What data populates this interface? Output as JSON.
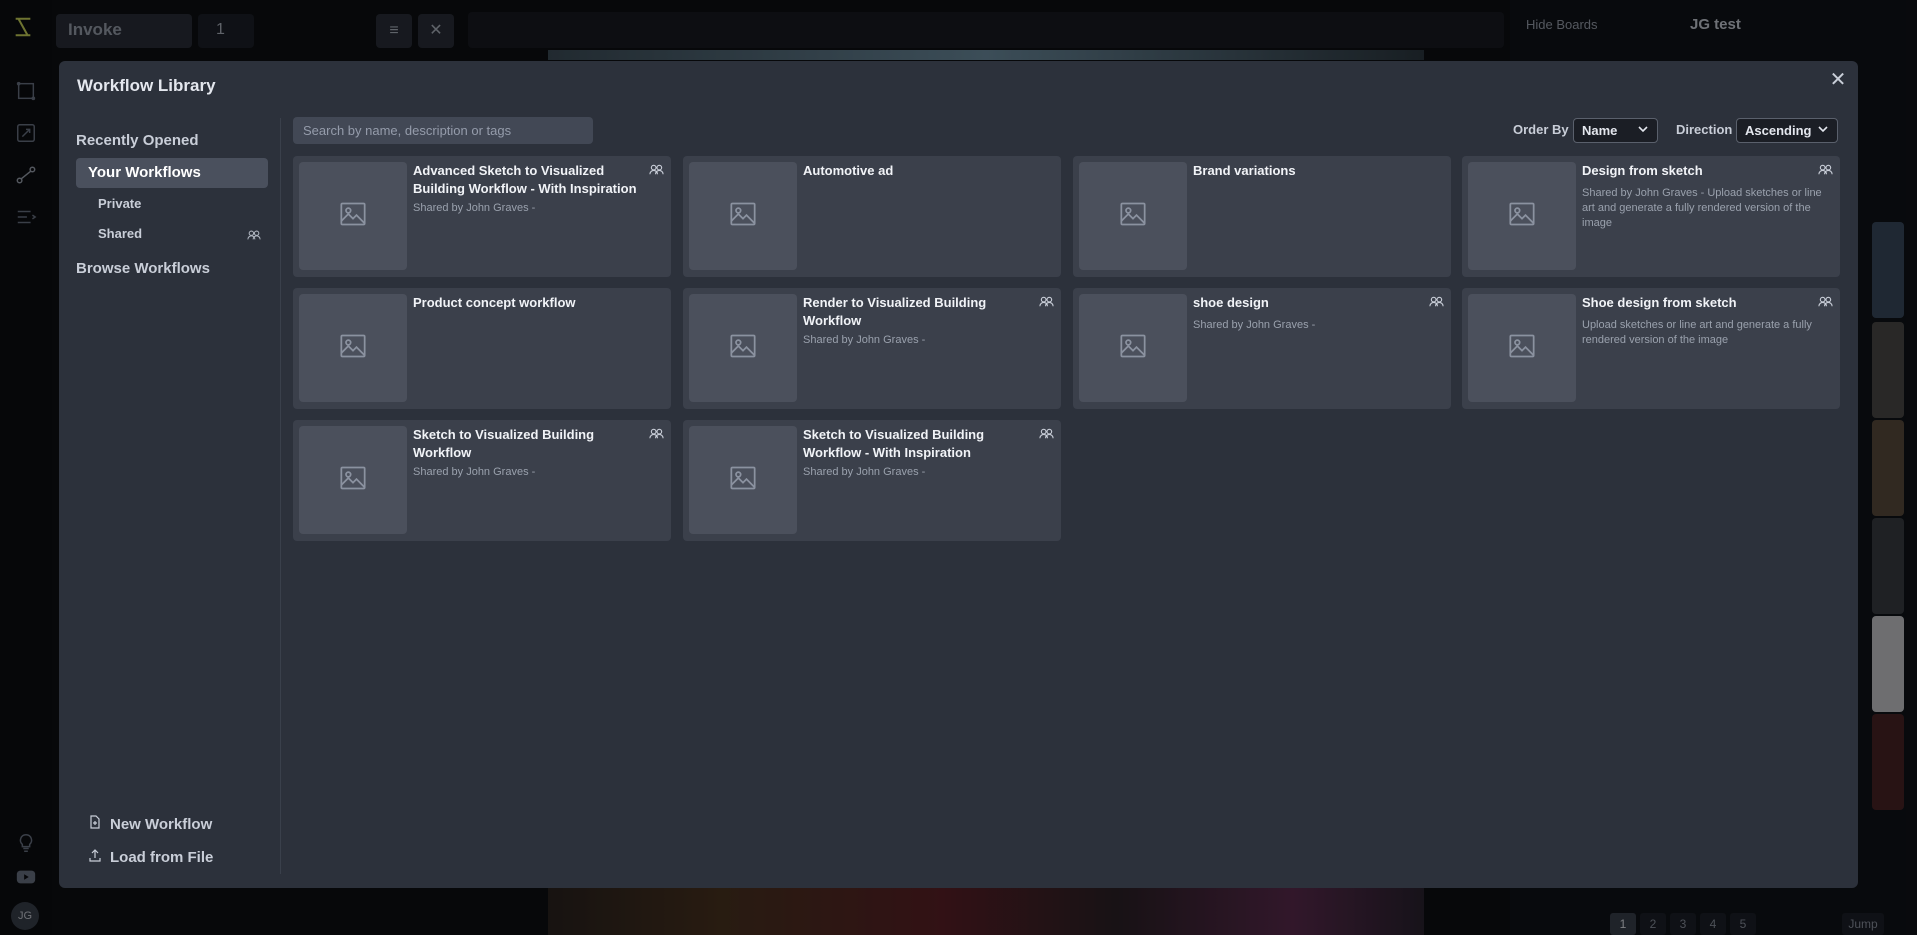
{
  "app": {
    "invoke_label": "Invoke",
    "iterations": "1",
    "hide_boards_label": "Hide Boards",
    "board_title": "JG test",
    "user_initials": "JG",
    "pages": [
      "1",
      "2",
      "3",
      "4",
      "5"
    ],
    "jump_label": "Jump"
  },
  "modal": {
    "title": "Workflow Library",
    "close_icon": "close-icon"
  },
  "sidebar": {
    "recently_opened": "Recently Opened",
    "your_workflows": "Your Workflows",
    "private": "Private",
    "shared": "Shared",
    "browse_workflows": "Browse Workflows",
    "new_workflow": "New Workflow",
    "load_from_file": "Load from File"
  },
  "controls": {
    "search_placeholder": "Search by name, description or tags",
    "order_by_label": "Order By",
    "order_by_value": "Name",
    "direction_label": "Direction",
    "direction_value": "Ascending"
  },
  "workflows": [
    {
      "title": "Advanced Sketch to Visualized Building Workflow - With Inspiration",
      "desc": "Shared by John Graves -",
      "shared": true
    },
    {
      "title": "Automotive ad",
      "desc": "",
      "shared": false
    },
    {
      "title": "Brand variations",
      "desc": "",
      "shared": false
    },
    {
      "title": "Design from sketch",
      "desc": "Shared by John Graves - Upload sketches or line art and generate a fully rendered version of the image",
      "shared": true
    },
    {
      "title": "Product concept workflow",
      "desc": "",
      "shared": false
    },
    {
      "title": "Render to Visualized Building Workflow",
      "desc": "Shared by John Graves -",
      "shared": true
    },
    {
      "title": "shoe design",
      "desc": "Shared by John Graves -",
      "shared": true
    },
    {
      "title": "Shoe design from sketch",
      "desc": "Upload sketches or line art and generate a fully rendered version of the image",
      "shared": true
    },
    {
      "title": "Sketch to Visualized Building Workflow",
      "desc": "Shared by John Graves -",
      "shared": true
    },
    {
      "title": "Sketch to Visualized Building Workflow - With Inspiration",
      "desc": "Shared by John Graves -",
      "shared": true
    }
  ],
  "colors": {
    "modal_bg": "#2c313b",
    "card_bg": "#3b404b",
    "selected_bg": "#4a505d",
    "accent": "#d4d45a"
  }
}
